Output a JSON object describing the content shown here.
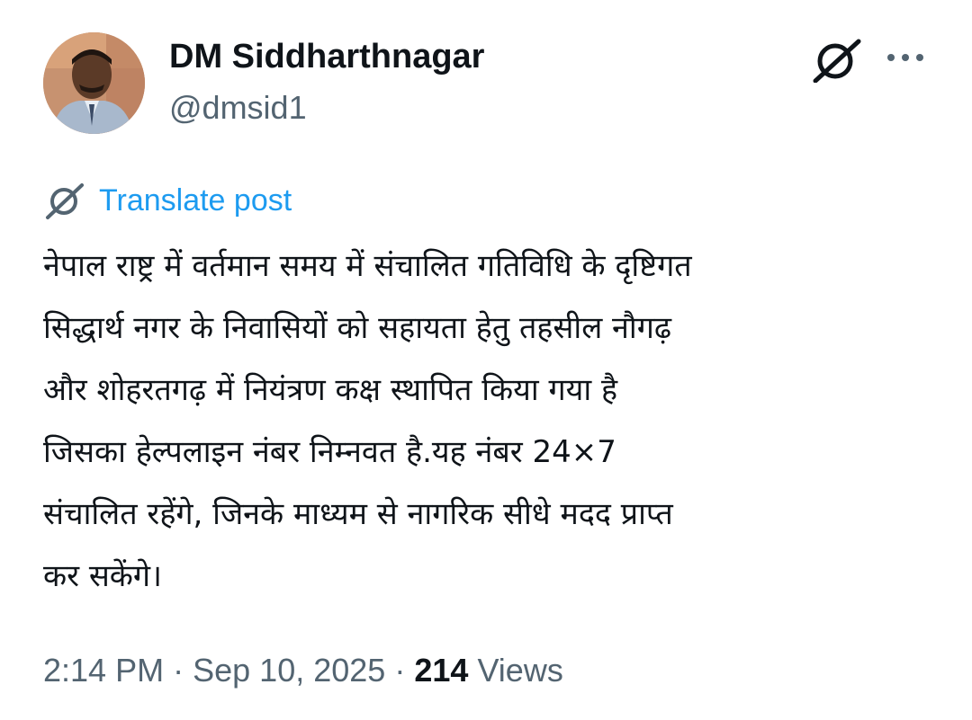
{
  "author": {
    "display_name": "DM Siddharthnagar",
    "handle": "@dmsid1"
  },
  "translate_link": "Translate post",
  "tweet": {
    "lines": [
      "नेपाल राष्ट्र में वर्तमान समय में संचालित गतिविधि के दृष्टिगत",
      "सिद्धार्थ नगर के निवासियों को सहायता हेतु तहसील नौगढ़",
      "और शोहरतगढ़ में नियंत्रण कक्ष स्थापित किया गया है",
      "जिसका हेल्पलाइन नंबर निम्नवत है.यह नंबर 24×7",
      "संचालित रहेंगे, जिनके माध्यम से नागरिक सीधे मदद प्राप्त",
      "कर सकेंगे।"
    ]
  },
  "meta": {
    "time": "2:14 PM",
    "separator": "·",
    "date": "Sep 10, 2025",
    "views_count": "214",
    "views_label": "Views"
  },
  "icons": {
    "grok": "grok-icon",
    "more": "more-icon",
    "translate": "grok-icon"
  },
  "colors": {
    "link": "#1d9bf0",
    "secondary_text": "#536471",
    "primary_text": "#0f1419"
  }
}
